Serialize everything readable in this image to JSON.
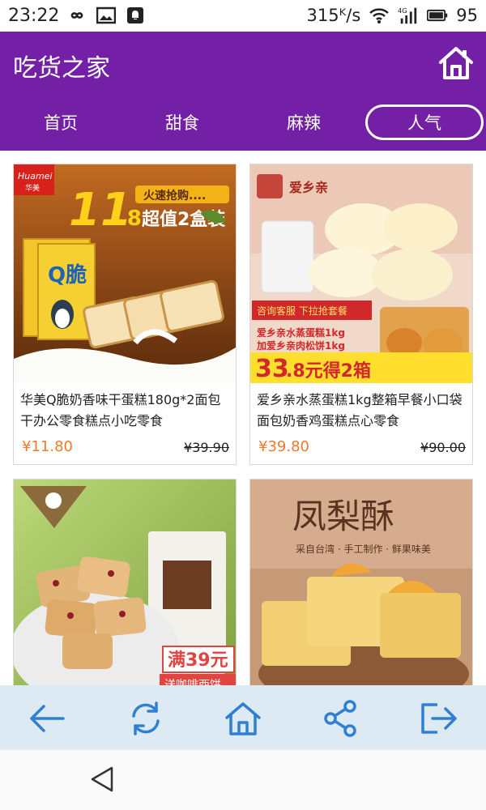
{
  "status_bar": {
    "time": "23:22",
    "speed": "315ᴷ/s",
    "network": "4G",
    "battery": "95"
  },
  "header": {
    "title": "吃货之家",
    "home_icon": "home-icon"
  },
  "tabs": [
    {
      "label": "首页",
      "active": false
    },
    {
      "label": "甜食",
      "active": false
    },
    {
      "label": "麻辣",
      "active": false
    },
    {
      "label": "人气",
      "active": true
    }
  ],
  "products": [
    {
      "title": "华美Q脆奶香味干蛋糕180g*2面包干办公零食糕点小吃零食",
      "price": "¥11.80",
      "original_price": "¥39.90",
      "image_text": {
        "brand": "Huamei",
        "brand_cn": "华美",
        "big": "11",
        "small": ".8",
        "suffix": "超值2盒装",
        "tag": "火速抢购....",
        "box_logo": "Q脆"
      }
    },
    {
      "title": "爱乡亲水蒸蛋糕1kg整箱早餐小口袋面包奶香鸡蛋糕点心零食",
      "price": "¥39.80",
      "original_price": "¥90.00",
      "image_text": {
        "brand": "爱乡亲",
        "banner": "咨询客服 下拉抢套餐",
        "line1": "爱乡亲水蒸蛋糕1kg",
        "line2": "加爱乡亲肉松饼1kg",
        "big": "33",
        "small": ".8元得2箱"
      }
    },
    {
      "title": "",
      "price": "",
      "original_price": "",
      "image_text": {
        "badge": "满39元",
        "sub": "送咖啡西饼"
      }
    },
    {
      "title": "",
      "price": "",
      "original_price": "",
      "image_text": {
        "headline": "凤梨酥",
        "sub": "采自台湾 · 手工制作 · 鲜果味美"
      }
    }
  ],
  "toolbar": {
    "buttons": [
      "back-arrow-icon",
      "refresh-icon",
      "home-icon",
      "share-icon",
      "exit-icon"
    ]
  },
  "colors": {
    "header": "#7420a6",
    "price": "#f07a2a",
    "toolbar": "#dde9f3",
    "toolbar_icon": "#2f80d1"
  }
}
